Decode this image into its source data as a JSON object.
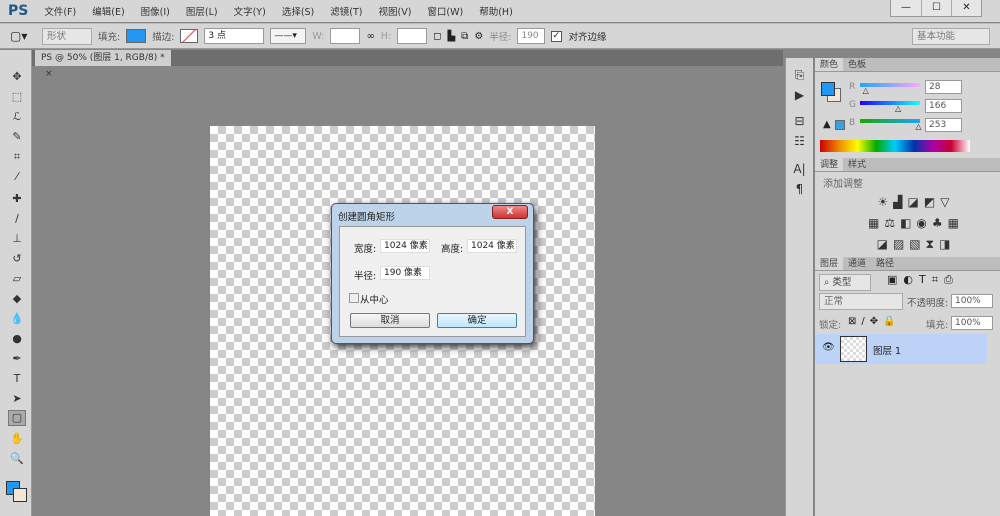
{
  "app": {
    "logo": "PS",
    "menus": [
      "文件(F)",
      "编辑(E)",
      "图像(I)",
      "图层(L)",
      "文字(Y)",
      "选择(S)",
      "滤镜(T)",
      "视图(V)",
      "窗口(W)",
      "帮助(H)"
    ],
    "window_buttons": [
      "—",
      "☐",
      "✕"
    ]
  },
  "options": {
    "shape_mode": "形状",
    "fill_label": "填充:",
    "fill_color": "#2196f3",
    "stroke_label": "描边:",
    "stroke_width": "3 点",
    "w_label": "W:",
    "h_label": "H:",
    "radius_label": "半径:",
    "radius_value": "190 像素",
    "align_edges": "对齐边缘",
    "workspace": "基本功能"
  },
  "document": {
    "tab": "PS @ 50% (图层 1, RGB/8) *",
    "close": "×"
  },
  "color_panel": {
    "tabs": [
      "颜色",
      "色板"
    ],
    "r_label": "R",
    "g_label": "G",
    "b_label": "B",
    "r": "28",
    "g": "166",
    "b": "253",
    "r_frac": 0.11,
    "g_frac": 0.65,
    "b_frac": 0.99
  },
  "adjust_panel": {
    "tabs": [
      "调整",
      "样式"
    ],
    "title": "添加调整"
  },
  "layers_panel": {
    "tabs": [
      "图层",
      "通道",
      "路径"
    ],
    "filter": "类型",
    "blend": "正常",
    "opacity_label": "不透明度:",
    "opacity": "100%",
    "lock_label": "锁定:",
    "fill_label": "填充:",
    "fill": "100%",
    "layers": [
      {
        "name": "图层 1"
      }
    ]
  },
  "dialog": {
    "title": "创建圆角矩形",
    "width_label": "宽度:",
    "width": "1024 像素",
    "height_label": "高度:",
    "height": "1024 像素",
    "radius_label": "半径:",
    "radius": "190 像素",
    "from_center": "从中心",
    "cancel": "取消",
    "ok": "确定",
    "close": "X"
  }
}
